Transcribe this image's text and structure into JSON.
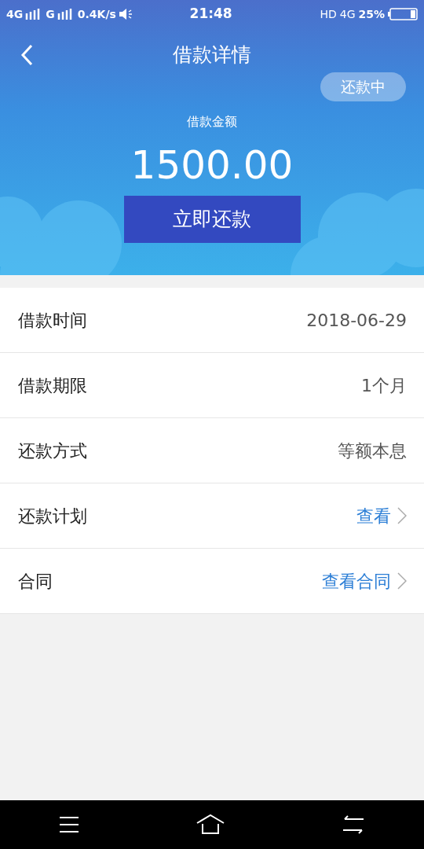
{
  "status_bar": {
    "network_1": "4G",
    "network_2": "G",
    "speed": "0.4K/s",
    "time": "21:48",
    "hd": "HD",
    "network_3": "4G",
    "battery": "25%"
  },
  "header": {
    "title": "借款详情",
    "status_badge": "还款中",
    "amount_label": "借款金额",
    "amount": "1500.00",
    "repay_button": "立即还款"
  },
  "rows": [
    {
      "label": "借款时间",
      "value": "2018-06-29",
      "kind": "text"
    },
    {
      "label": "借款期限",
      "value": "1个月",
      "kind": "text"
    },
    {
      "label": "还款方式",
      "value": "等额本息",
      "kind": "text"
    },
    {
      "label": "还款计划",
      "value": "查看",
      "kind": "link"
    },
    {
      "label": "合同",
      "value": "查看合同",
      "kind": "link"
    }
  ]
}
